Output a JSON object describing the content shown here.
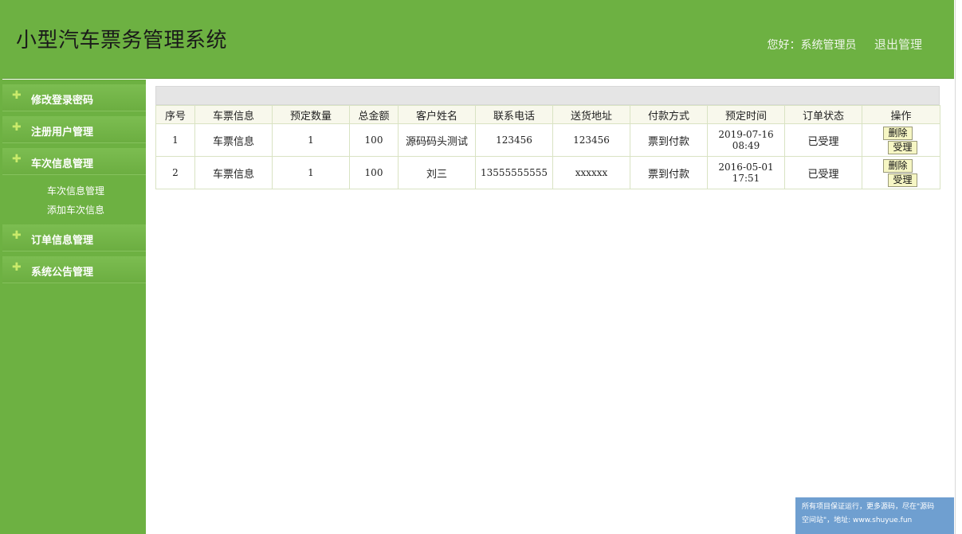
{
  "app": {
    "title": "小型汽车票务管理系统",
    "greeting": "您好：系统管理员",
    "logout": "退出管理"
  },
  "sidebar": {
    "items": [
      {
        "label": "修改登录密码"
      },
      {
        "label": "注册用户管理"
      },
      {
        "label": "车次信息管理"
      },
      {
        "label": "订单信息管理"
      },
      {
        "label": "系统公告管理"
      }
    ],
    "submenu": [
      "车次信息管理",
      "添加车次信息"
    ]
  },
  "table": {
    "headers": [
      "序号",
      "车票信息",
      "预定数量",
      "总金额",
      "客户姓名",
      "联系电话",
      "送货地址",
      "付款方式",
      "预定时间",
      "订单状态",
      "操作"
    ],
    "rows": [
      {
        "no": "1",
        "ticket": "车票信息",
        "qty": "1",
        "total": "100",
        "customer": "源码码头测试",
        "phone": "123456",
        "address": "123456",
        "pay": "票到付款",
        "time": "2019-07-16 08:49",
        "status": "已受理"
      },
      {
        "no": "2",
        "ticket": "车票信息",
        "qty": "1",
        "total": "100",
        "customer": "刘三",
        "phone": "13555555555",
        "address": "xxxxxx",
        "pay": "票到付款",
        "time": "2016-05-01 17:51",
        "status": "已受理"
      }
    ],
    "delete_label": "删除",
    "accept_label": "受理"
  },
  "footer": {
    "line1": "所有项目保证运行，更多源码，尽在\"源码",
    "line2": "空间站\"，地址: www.shuyue.fun"
  },
  "colors": {
    "header_green": "#6db142",
    "sidebar_green": "#6db142",
    "button_yellow": "#f6f6c4",
    "footer_blue": "#6f9fd0"
  }
}
